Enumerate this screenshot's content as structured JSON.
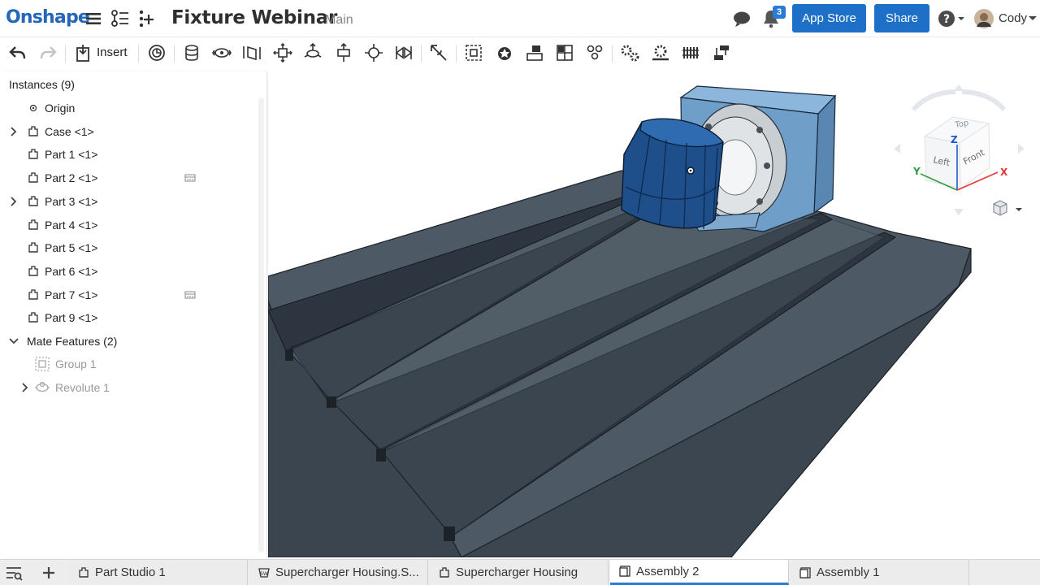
{
  "app": {
    "logo": "Onshape"
  },
  "document": {
    "title": "Fixture Webinar",
    "branch": "Main"
  },
  "header": {
    "notification_count": "3",
    "app_store_label": "App Store",
    "share_label": "Share",
    "user_name": "Cody"
  },
  "toolbar": {
    "insert_label": "Insert",
    "icons": [
      "undo-icon",
      "redo-icon",
      "insert-icon",
      "history-icon",
      "fastened-mate-icon",
      "revolute-mate-icon",
      "slider-mate-icon",
      "planar-mate-icon",
      "cylindrical-mate-icon",
      "pin-slot-mate-icon",
      "ball-mate-icon",
      "parallel-mate-icon",
      "tangent-mate-icon",
      "mate-connector-icon",
      "group-icon",
      "replicate-icon",
      "pattern-icon",
      "linear-pattern-icon",
      "gear-relation-icon",
      "rack-pinion-icon",
      "screw-relation-icon",
      "linear-relation-icon"
    ]
  },
  "instances": {
    "title": "Instances (9)",
    "items": [
      {
        "label": "Origin",
        "type": "origin",
        "expandable": false
      },
      {
        "label": "Case <1>",
        "type": "subassembly",
        "expandable": true
      },
      {
        "label": "Part 1 <1>",
        "type": "part",
        "expandable": false
      },
      {
        "label": "Part 2 <1>",
        "type": "part",
        "expandable": false,
        "hint": true
      },
      {
        "label": "Part 3 <1>",
        "type": "subassembly",
        "expandable": true
      },
      {
        "label": "Part 4 <1>",
        "type": "part",
        "expandable": false
      },
      {
        "label": "Part 5 <1>",
        "type": "part",
        "expandable": false
      },
      {
        "label": "Part 6 <1>",
        "type": "part",
        "expandable": false
      },
      {
        "label": "Part 7 <1>",
        "type": "part",
        "expandable": false,
        "hint": true
      },
      {
        "label": "Part 9 <1>",
        "type": "part",
        "expandable": false
      }
    ],
    "mate_features": {
      "label": "Mate Features (2)",
      "items": [
        {
          "label": "Group 1",
          "expandable": false
        },
        {
          "label": "Revolute 1",
          "expandable": true
        }
      ]
    }
  },
  "view_cube": {
    "top": "Top",
    "left": "Left",
    "front": "Front",
    "axes": [
      "X",
      "Y",
      "Z"
    ]
  },
  "tabs": [
    {
      "label": "Part Studio 1",
      "icon": "part-studio-icon",
      "active": false
    },
    {
      "label": "Supercharger Housing.S...",
      "icon": "imported-file-icon",
      "active": false
    },
    {
      "label": "Supercharger Housing",
      "icon": "part-studio-icon",
      "active": false
    },
    {
      "label": "Assembly 2",
      "icon": "assembly-icon",
      "active": true
    },
    {
      "label": "Assembly 1",
      "icon": "assembly-icon",
      "active": false
    }
  ],
  "colors": {
    "brand": "#2466b8",
    "button": "#1e6fc7",
    "table": "#4d5964",
    "housing": "#6f9ec8",
    "part": "#1e4f8a",
    "axis_x": "#e53935",
    "axis_y": "#2e9e3a",
    "axis_z": "#1f56d6"
  }
}
